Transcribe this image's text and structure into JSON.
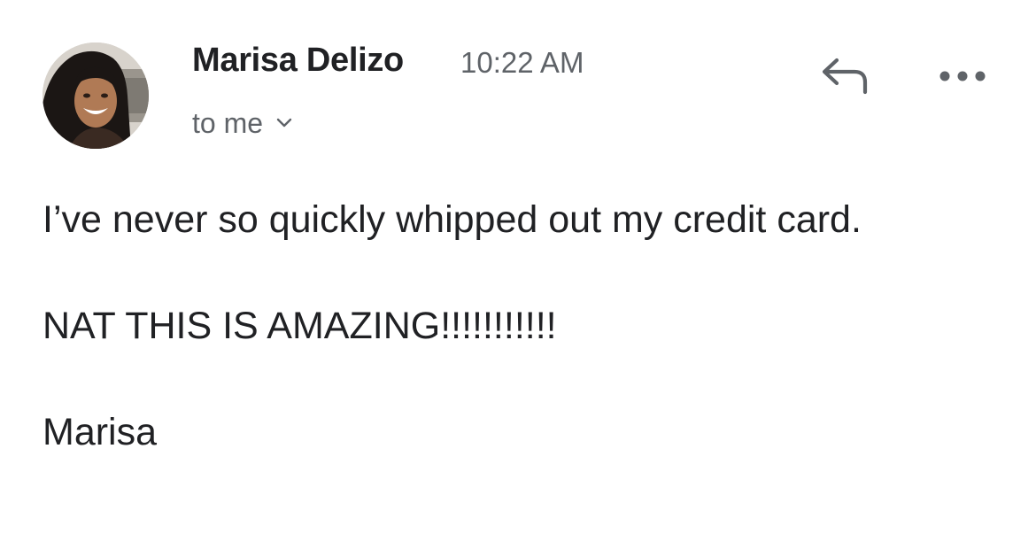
{
  "header": {
    "sender_name": "Marisa Delizo",
    "timestamp": "10:22 AM",
    "recipient_label": "to me",
    "avatar_alt": "Marisa Delizo avatar",
    "icons": {
      "reply": "reply-icon",
      "more": "more-options-icon",
      "expand": "chevron-down-icon"
    }
  },
  "body": {
    "paragraphs": [
      "I’ve never so quickly whipped out my credit card.",
      "NAT THIS IS AMAZING!!!!!!!!!!!",
      "Marisa"
    ]
  },
  "colors": {
    "text_primary": "#202124",
    "text_secondary": "#5f6368",
    "icon": "#5f6368",
    "background": "#ffffff"
  }
}
